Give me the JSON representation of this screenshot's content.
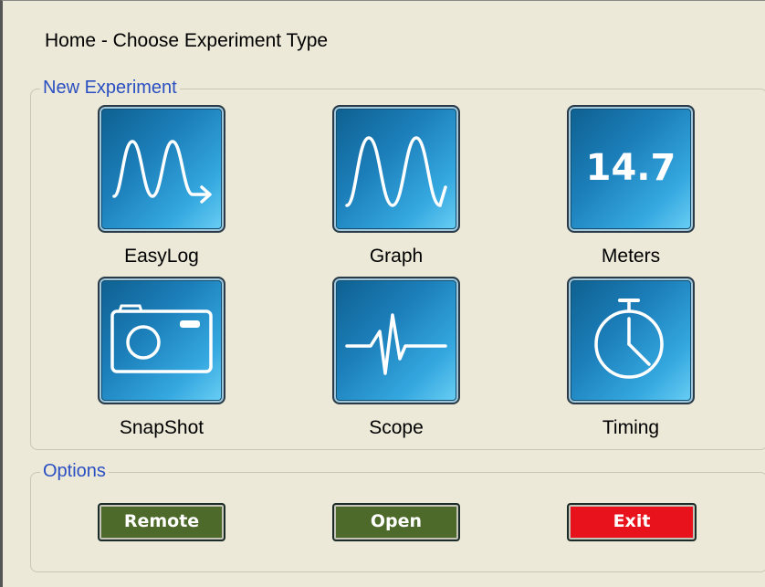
{
  "header": {
    "title": "Home - Choose Experiment Type"
  },
  "new_experiment": {
    "legend": "New Experiment",
    "tiles": [
      {
        "label": "EasyLog",
        "icon": "wave-arrow-icon"
      },
      {
        "label": "Graph",
        "icon": "sine-wave-icon"
      },
      {
        "label": "Meters",
        "icon": "meter-readout-icon",
        "readout": "14.7"
      },
      {
        "label": "SnapShot",
        "icon": "camera-icon"
      },
      {
        "label": "Scope",
        "icon": "pulse-trace-icon"
      },
      {
        "label": "Timing",
        "icon": "stopwatch-icon"
      }
    ]
  },
  "options": {
    "legend": "Options",
    "buttons": [
      {
        "label": "Remote",
        "color": "#4d6a2a"
      },
      {
        "label": "Open",
        "color": "#4d6a2a"
      },
      {
        "label": "Exit",
        "color": "#e8121c"
      }
    ]
  },
  "colors": {
    "tile_gradient_dark": "#0e5f8f",
    "tile_gradient_light": "#6cd0f5",
    "legend_text": "#2a4fc2"
  }
}
